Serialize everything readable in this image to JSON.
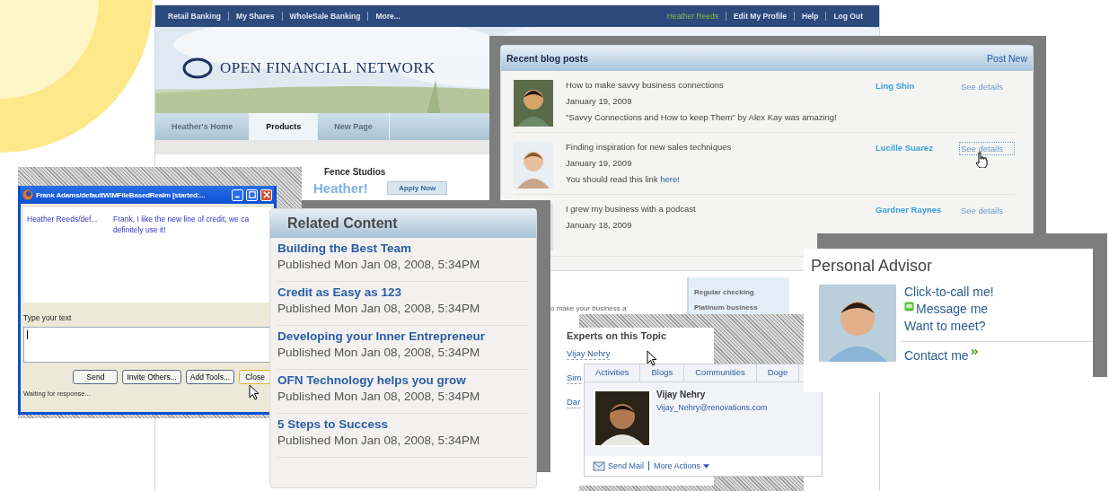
{
  "site": {
    "nav": [
      "Retail Banking",
      "My Shares",
      "WholeSale Banking",
      "More..."
    ],
    "user_links": [
      {
        "label": "Heather Reeds",
        "kind": "user"
      },
      {
        "label": "Edit My Profile",
        "kind": "link"
      },
      {
        "label": "Help",
        "kind": "link"
      },
      {
        "label": "Log Out",
        "kind": "link"
      }
    ],
    "logo": "OPEN FINANCIAL NETWORK",
    "tabs": [
      {
        "label": "Heather's Home",
        "selected": false
      },
      {
        "label": "Products",
        "selected": true
      },
      {
        "label": "New Page",
        "selected": false
      }
    ],
    "heading": "Fence Studios",
    "greeting": "Heather!",
    "apply_button": "Apply Now",
    "snippet": "o make your business a",
    "products": [
      "Regular checking",
      "Platinum business"
    ]
  },
  "blog": {
    "title": "Recent blog posts",
    "post_new": "Post New",
    "posts": [
      {
        "title": "How to make savvy business connections",
        "date": "January 19, 2009",
        "excerpt": "\"Savvy Connections and How to keep Them\" by Alex Kay was amazing!",
        "author": "Ling Shin",
        "details": "See details",
        "focused": false
      },
      {
        "title": "Finding inspiration for new sales techniques",
        "date": "January 19, 2009",
        "excerpt": "You should read this link ",
        "link": "here!",
        "author": "Lucille Suarez",
        "details": "See details",
        "focused": true
      },
      {
        "title": "I grew my business with a podcast",
        "date": "January 18, 2009",
        "author": "Gardner Raynes",
        "details": "See details",
        "focused": false
      }
    ]
  },
  "chat": {
    "title": "Frank Adams/defaultWIMFileBasedRealm [started:...",
    "messages": [
      {
        "sender": "Heather Reeds/def...",
        "lines": [
          "Frank, I like the new line of credit, we ca",
          "definitely use it!"
        ]
      }
    ],
    "input_label": "Type your text",
    "buttons": [
      "Send",
      "Invite Others...",
      "Add Tools...",
      "Close"
    ],
    "status": "Waiting for response..."
  },
  "related": {
    "title": "Related Content",
    "items": [
      {
        "title": "Building the Best Team",
        "meta": "Published Mon Jan 08, 2008, 5:34PM"
      },
      {
        "title": "Credit as Easy as 123",
        "meta": "Published Mon Jan 08, 2008, 5:34PM"
      },
      {
        "title": "Developing your Inner Entrepreneur",
        "meta": "Published Mon Jan 08, 2008, 5:34PM"
      },
      {
        "title": "OFN Technology helps you grow",
        "meta": "Published Mon Jan 08, 2008, 5:34PM"
      },
      {
        "title": "5 Steps to Success",
        "meta": "Published Mon Jan 08, 2008, 5:34PM"
      }
    ]
  },
  "experts": {
    "title": "Experts on this Topic",
    "people": [
      "Vijay Nehry",
      "Sim",
      "Dar"
    ],
    "card": {
      "tabs": [
        "Activities",
        "Blogs",
        "Communities",
        "Doge"
      ],
      "name": "Vijay Nehry",
      "email": "Vijay_Nehry@renovations.com",
      "actions": [
        "Send Mail",
        "More Actions"
      ]
    }
  },
  "advisor": {
    "title": "Personal Advisor",
    "links": [
      {
        "label": "Click-to-call me!",
        "kind": "plain"
      },
      {
        "label": "Message me",
        "kind": "message"
      },
      {
        "label": "Want to meet?",
        "kind": "plain"
      }
    ],
    "contact": "Contact me"
  }
}
